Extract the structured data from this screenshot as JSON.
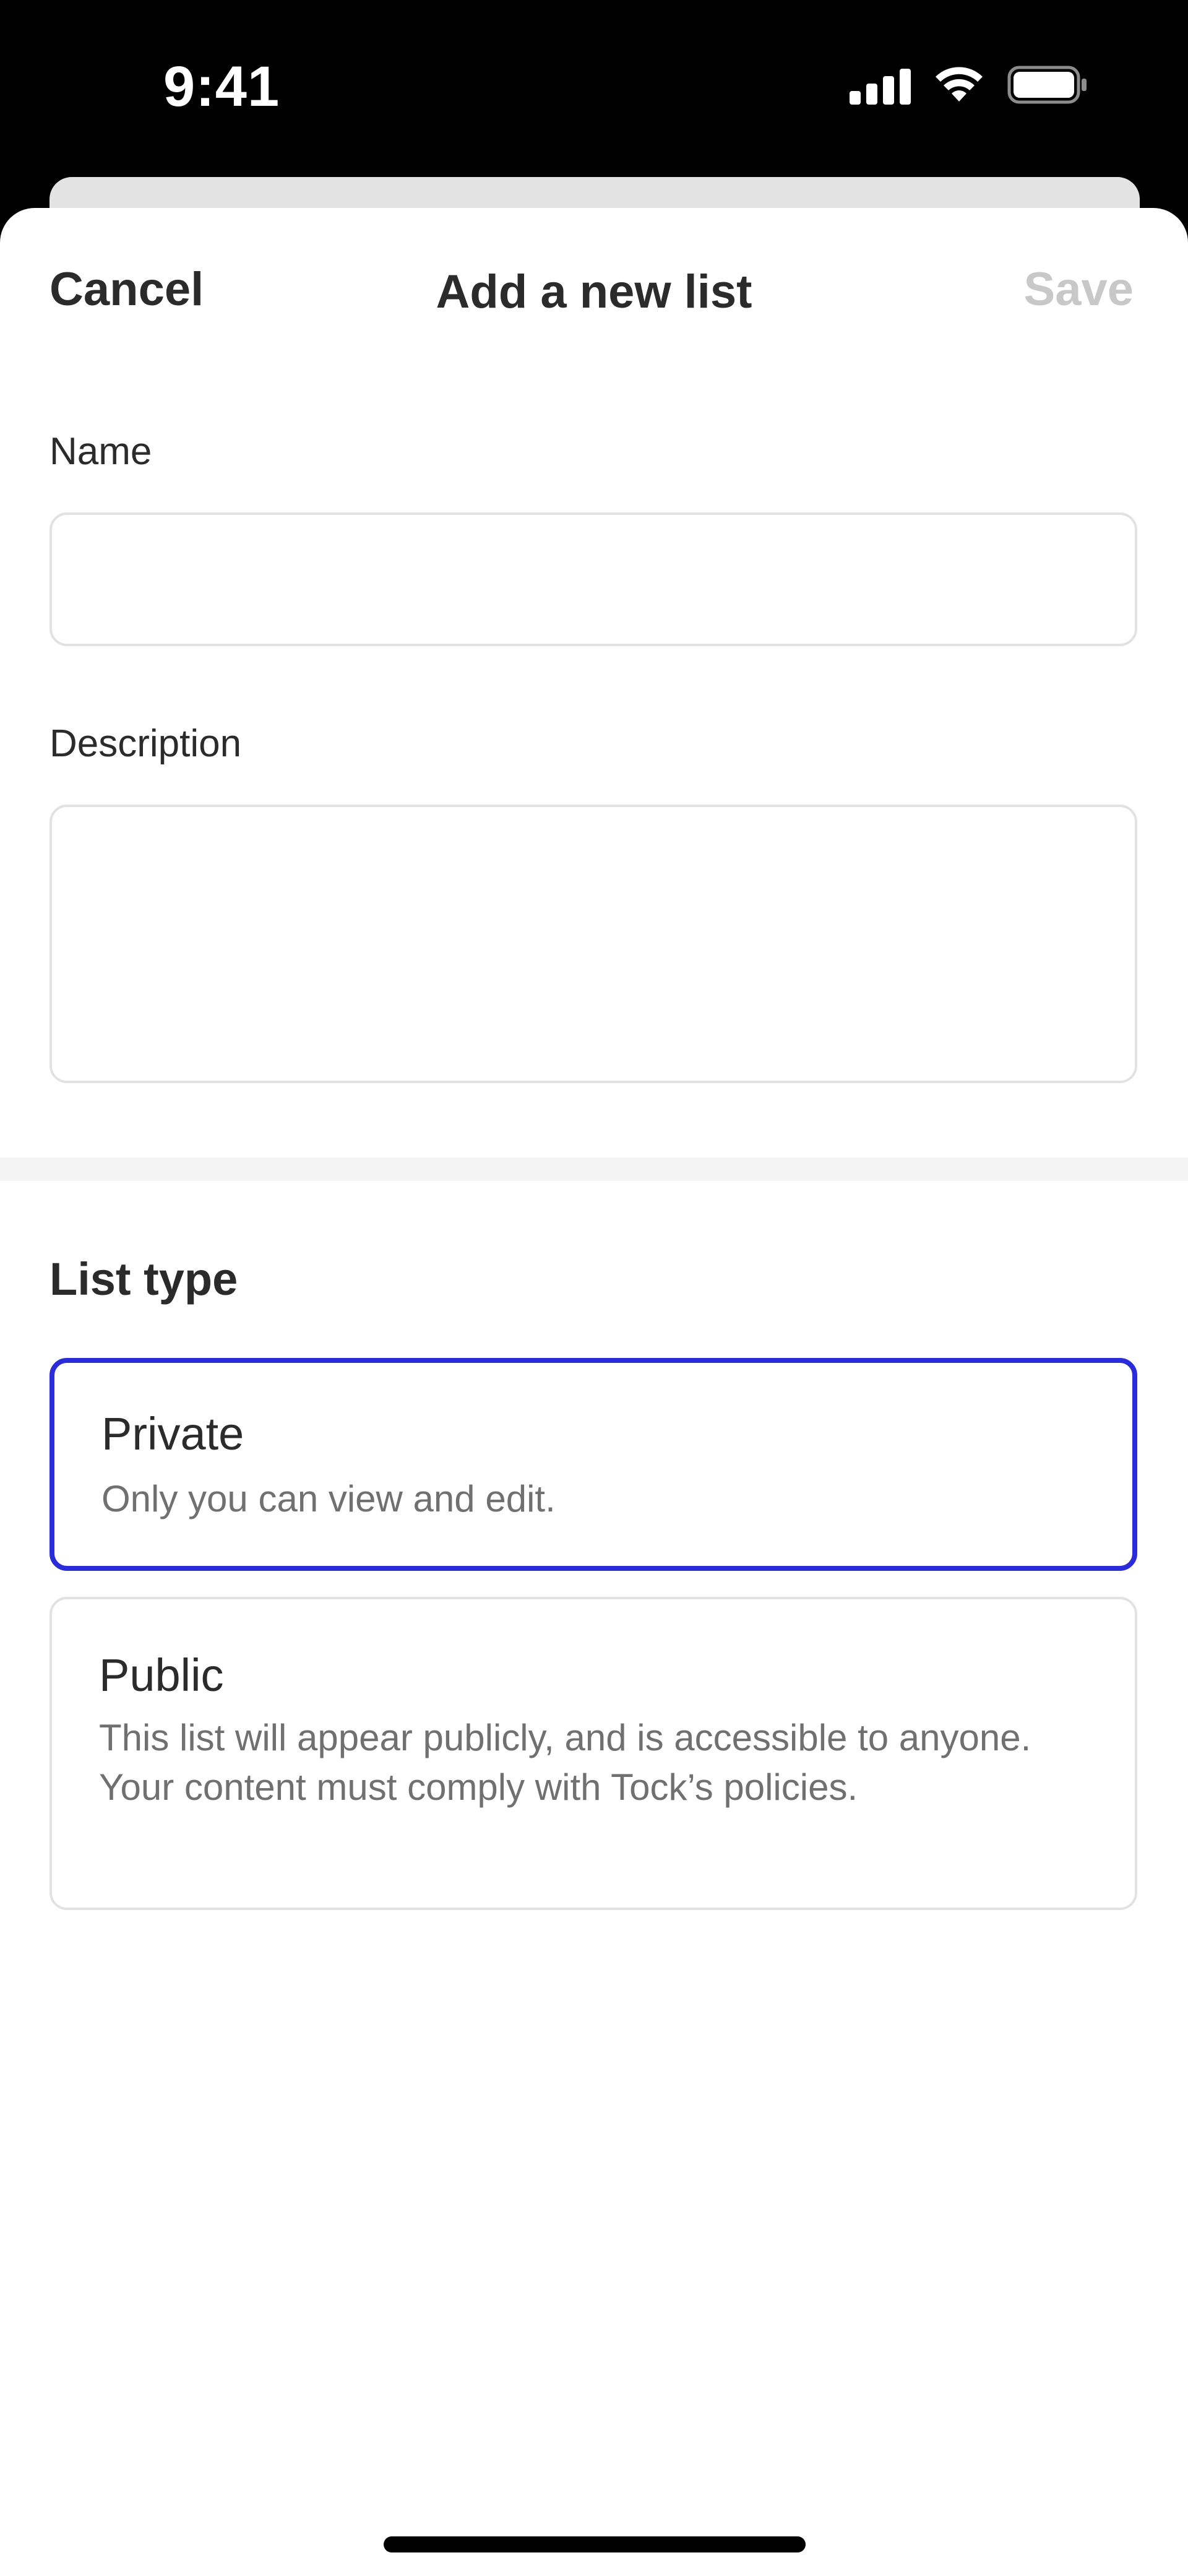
{
  "status_bar": {
    "time": "9:41",
    "icons": [
      "cellular-signal-icon",
      "wifi-icon",
      "battery-icon"
    ],
    "battery_level": 1.0
  },
  "nav": {
    "cancel_label": "Cancel",
    "title": "Add a new list",
    "save_label": "Save"
  },
  "form": {
    "name_label": "Name",
    "name_value": "",
    "description_label": "Description",
    "description_value": ""
  },
  "list_type": {
    "section_title": "List type",
    "selected": "private",
    "options": [
      {
        "id": "private",
        "title": "Private",
        "description": "Only you can view and edit."
      },
      {
        "id": "public",
        "title": "Public",
        "description": "This list will appear publicly, and is accessible to anyone. Your content must comply with Tock’s policies."
      }
    ]
  },
  "colors": {
    "accent": "#2a2bd9",
    "save_disabled": "#c8c8c8",
    "text_primary": "#2b2b2b",
    "text_secondary": "#707070",
    "border": "#e2e2e2"
  }
}
